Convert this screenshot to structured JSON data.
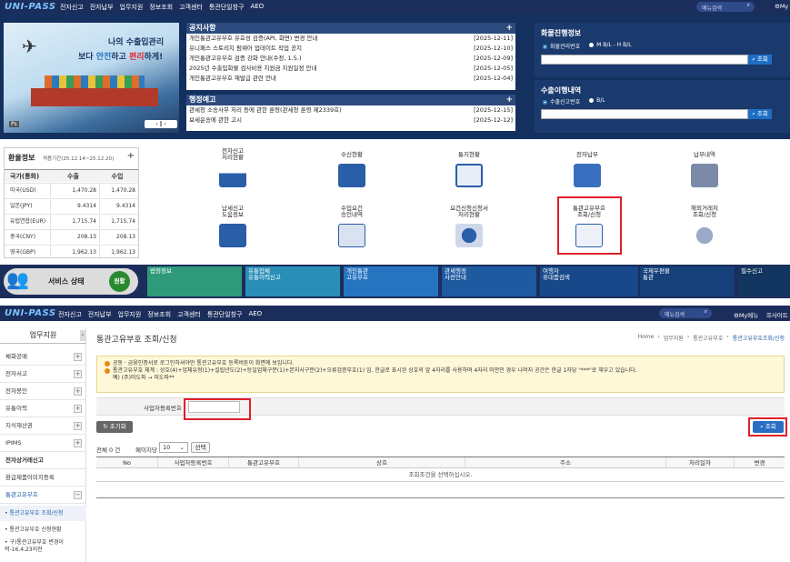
{
  "top_header": {
    "logo": "UNI-PASS",
    "nav": [
      "전자신고",
      "전자납부",
      "업무지원",
      "정보조회",
      "고객센터",
      "통관단일창구",
      "AEO"
    ],
    "search_placeholder": "메뉴검색",
    "my": "My"
  },
  "banner": {
    "line1": "나의 수출입관리",
    "line2_a": "보다 ",
    "line2_b": "안전",
    "line2_c": "하고 ",
    "line2_d": "편리",
    "line2_e": "하게!",
    "controls": "‹ ‖ ›",
    "ps": "Ps"
  },
  "notices": {
    "title": "공지사항",
    "items": [
      {
        "t": "개인통관고유부호 유효성 검증(API, 화면) 변경 안내",
        "d": "[2025-12-11]"
      },
      {
        "t": "유니패스 스토리지 펌웨어 업데이트 작업 공지",
        "d": "[2025-12-10]"
      },
      {
        "t": "개인통관고유부호 검증 강화 안내(수정, 1.5.)",
        "d": "[2025-12-09]"
      },
      {
        "t": "2025년 수출입화물 검사비용 지원금 지원일정 안내",
        "d": "[2025-12-05]"
      },
      {
        "t": "개인통관고유부호 재발급 관련 안내",
        "d": "[2025-12-04]"
      }
    ]
  },
  "admin_notices": {
    "title": "행정예고",
    "items": [
      {
        "t": "관세청 소송사무 처리 등에 관한 훈령(관세청 훈령 제2339호)",
        "d": "[2025-12-15]"
      },
      {
        "t": "보세운송에 관한 고시",
        "d": "[2025-12-12]"
      }
    ]
  },
  "cargo": {
    "title": "화물진행정보",
    "r1": "화물관리번호",
    "r2": "M B/L - H B/L",
    "btn": "조회"
  },
  "export": {
    "title": "수출이행내역",
    "r1": "수출신고번호",
    "r2": "B/L",
    "btn": "조회"
  },
  "fx": {
    "title": "환율정보",
    "period": "적용기간(25.12.14~25.12.20)",
    "plus": "+",
    "h": [
      "국가(통화)",
      "수출",
      "수입"
    ],
    "rows": [
      [
        "미국(USD)",
        "1,470.28",
        "1,470.28"
      ],
      [
        "일본(JPY)",
        "9.4314",
        "9.4314"
      ],
      [
        "유럽연합(EUR)",
        "1,715.74",
        "1,715.74"
      ],
      [
        "중국(CNY)",
        "208.13",
        "208.13"
      ],
      [
        "영국(GBP)",
        "1,962.13",
        "1,962.13"
      ]
    ]
  },
  "menu": [
    {
      "l1": "전자신고",
      "l2": "처리현황"
    },
    {
      "l1": "수신현황",
      "l2": ""
    },
    {
      "l1": "통지현황",
      "l2": ""
    },
    {
      "l1": "전자납부",
      "l2": ""
    },
    {
      "l1": "납부내역",
      "l2": ""
    },
    {
      "l1": "납세신고",
      "l2": "도움정보"
    },
    {
      "l1": "수입요건",
      "l2": "승인내역"
    },
    {
      "l1": "요건신청신청서",
      "l2": "처리현황"
    },
    {
      "l1": "통관고유부호",
      "l2": "조회/신청"
    },
    {
      "l1": "해외거래처",
      "l2": "조회/신청"
    }
  ],
  "service": {
    "label": "서비스 상태",
    "status": "원활"
  },
  "tiles": [
    {
      "l1": "법령정보",
      "l2": ""
    },
    {
      "l1": "유통업체",
      "l2": "유통이력신고"
    },
    {
      "l1": "개인통관",
      "l2": "고유부호"
    },
    {
      "l1": "관세행정",
      "l2": "사전안내"
    },
    {
      "l1": "여행자",
      "l2": "휴대품검색"
    },
    {
      "l1": "국제우편물",
      "l2": "통관"
    },
    {
      "l1": "필수신고",
      "l2": ""
    }
  ],
  "header2": {
    "nav": [
      "전자신고",
      "전자납부",
      "업무지원",
      "정보조회",
      "고객센터",
      "통관단일창구",
      "AEO"
    ],
    "search_placeholder": "메뉴검색",
    "my": "My메뉴",
    "site": "사이트"
  },
  "sidebar": {
    "title": "업무지원",
    "arrow": "‹",
    "items": [
      "체화공매",
      "전자서고",
      "전자봉인",
      "유통이력",
      "지식재산권",
      "IPIMS",
      "전자상거래신고",
      "환급제품이미지등록",
      "통관고유부호"
    ],
    "tog": "+",
    "tog2": "−",
    "sub": [
      "통관고유부호 조회/신청",
      "통관고유부호 신청현황",
      "구)통관고유부호 변경이력-16.4.23이전"
    ]
  },
  "page": {
    "title": "통관고유부호 조회/신청",
    "breadcrumb": [
      "Home",
      "업무지원",
      "통관고유부호",
      "통관고유부호조회/신청"
    ],
    "notice1": "공동 · 금융인증서로 로그인하셔야만 통관고유부호 등록버튼이 화면에 보입니다.",
    "notice2": "통관고유부호 체계 : 상호(4)+업체유형(1)+설립년도(2)+등일업체구분(1)+본지사구분(2)+오류검증부호(1) 임. 한글로 표시된 상호의 앞 4자리를 사용하며 4자리 미만인 경우 나머지 공간은 한글 1자당 \"***\"로 채우고 있습니다.",
    "notice3": "예) (주)미도파 → 미도파**",
    "field_label": "사업자등록번호",
    "reset": "초기화",
    "search": "조회",
    "total": "전체 0 건",
    "per_page_label": "페이지당",
    "per_page": "10",
    "select_btn": "선택",
    "cols": [
      "No",
      "사업자등록번호",
      "통관고유부호",
      "상호",
      "주소",
      "처리일자",
      "변경"
    ],
    "empty": "조회조건을 선택하십시오."
  }
}
